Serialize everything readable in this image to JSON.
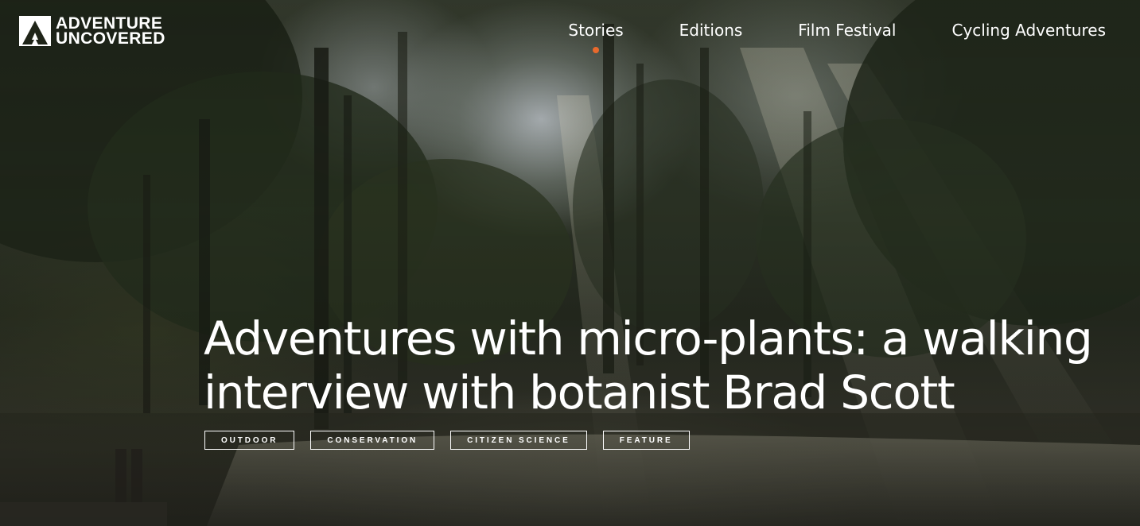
{
  "brand": {
    "line1": "ADVENTURE",
    "line2": "UNCOVERED",
    "icon": "mountain-logo-icon"
  },
  "nav": {
    "items": [
      {
        "label": "Stories",
        "active": true
      },
      {
        "label": "Editions",
        "active": false
      },
      {
        "label": "Film Festival",
        "active": false
      },
      {
        "label": "Cycling Adventures",
        "active": false
      }
    ],
    "active_indicator_color": "#e8692d"
  },
  "article": {
    "title": "Adventures with micro-plants: a walking interview with botanist Brad Scott",
    "tags": [
      "OUTDOOR",
      "CONSERVATION",
      "CITIZEN SCIENCE",
      "FEATURE"
    ]
  },
  "colors": {
    "text": "#ffffff",
    "accent": "#e8692d"
  }
}
